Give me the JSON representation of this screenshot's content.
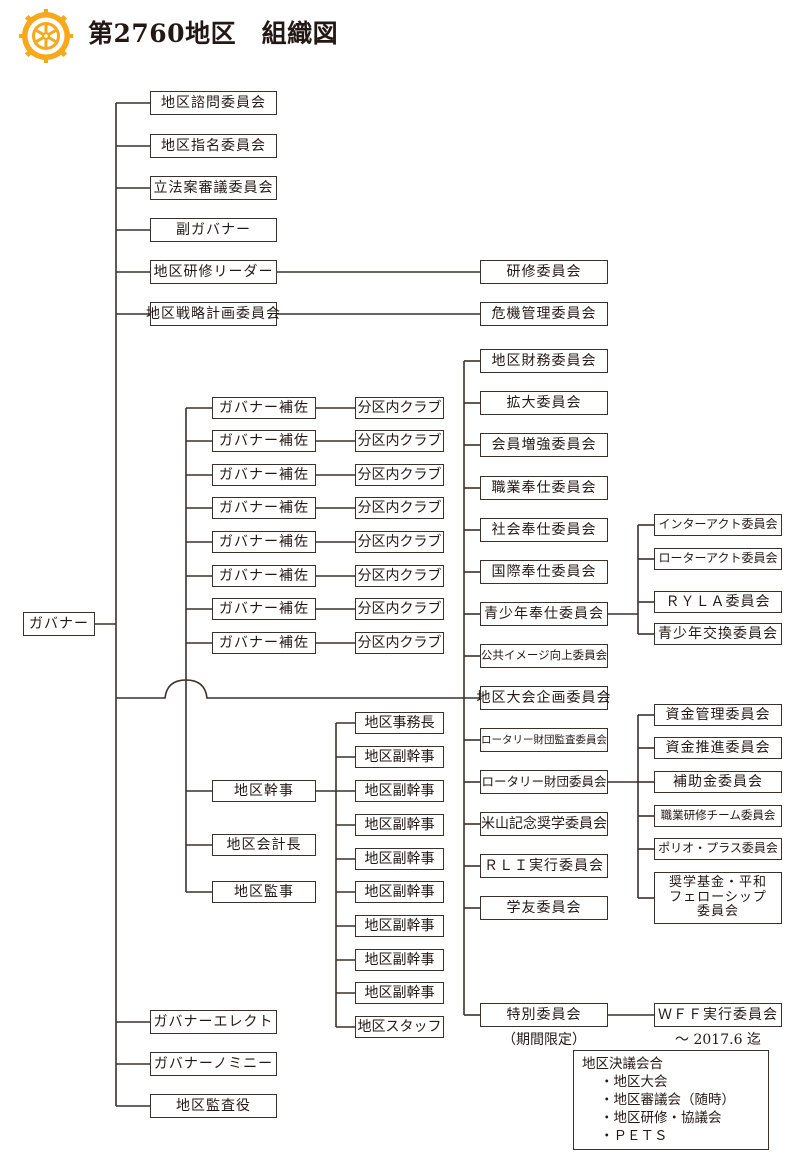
{
  "header": {
    "title": "第2760地区　組織図",
    "logo": "rotary-international-wheel-logo",
    "logo_color": "#F7A81B"
  },
  "line_color": "#3a302c",
  "root": {
    "label": "ガバナー"
  },
  "top_level": [
    {
      "label": "地区諮問委員会"
    },
    {
      "label": "地区指名委員会"
    },
    {
      "label": "立法案審議委員会"
    },
    {
      "label": "副ガバナー"
    },
    {
      "label": "地区研修リーダー",
      "child": "研修委員会"
    },
    {
      "label": "地区戦略計画委員会",
      "child": "危機管理委員会"
    }
  ],
  "assistant_governors": [
    {
      "label": "ガバナー補佐",
      "child": "分区内クラブ"
    },
    {
      "label": "ガバナー補佐",
      "child": "分区内クラブ"
    },
    {
      "label": "ガバナー補佐",
      "child": "分区内クラブ"
    },
    {
      "label": "ガバナー補佐",
      "child": "分区内クラブ"
    },
    {
      "label": "ガバナー補佐",
      "child": "分区内クラブ"
    },
    {
      "label": "ガバナー補佐",
      "child": "分区内クラブ"
    },
    {
      "label": "ガバナー補佐",
      "child": "分区内クラブ"
    },
    {
      "label": "ガバナー補佐",
      "child": "分区内クラブ"
    }
  ],
  "secretariat": {
    "main": [
      {
        "label": "地区幹事"
      },
      {
        "label": "地区会計長"
      },
      {
        "label": "地区監事"
      }
    ],
    "staff": [
      {
        "label": "地区事務長"
      },
      {
        "label": "地区副幹事"
      },
      {
        "label": "地区副幹事"
      },
      {
        "label": "地区副幹事"
      },
      {
        "label": "地区副幹事"
      },
      {
        "label": "地区副幹事"
      },
      {
        "label": "地区副幹事"
      },
      {
        "label": "地区副幹事"
      },
      {
        "label": "地区副幹事"
      },
      {
        "label": "地区スタッフ"
      }
    ]
  },
  "committees": [
    {
      "label": "地区財務委員会"
    },
    {
      "label": "拡大委員会"
    },
    {
      "label": "会員増強委員会"
    },
    {
      "label": "職業奉仕委員会"
    },
    {
      "label": "社会奉仕委員会"
    },
    {
      "label": "国際奉仕委員会"
    },
    {
      "label": "青少年奉仕委員会"
    },
    {
      "label": "公共イメージ向上委員会"
    },
    {
      "label": "地区大会企画委員会"
    },
    {
      "label": "ロータリー財団監査委員会"
    },
    {
      "label": "ロータリー財団委員会"
    },
    {
      "label": "米山記念奨学委員会"
    },
    {
      "label": "ＲＬＩ実行委員会"
    },
    {
      "label": "学友委員会"
    },
    {
      "label": "特別委員会",
      "note": "（期間限定）"
    }
  ],
  "youth_subcommittees": [
    {
      "label": "インターアクト委員会"
    },
    {
      "label": "ローターアクト委員会"
    },
    {
      "label": "ＲＹＬＡ委員会"
    },
    {
      "label": "青少年交換委員会"
    }
  ],
  "foundation_subcommittees": [
    {
      "label": "資金管理委員会"
    },
    {
      "label": "資金推進委員会"
    },
    {
      "label": "補助金委員会"
    },
    {
      "label": "職業研修チーム委員会"
    },
    {
      "label": "ポリオ・プラス委員会"
    },
    {
      "label": [
        "奨学基金・平和",
        "フェローシップ",
        "委員会"
      ]
    }
  ],
  "special_subcommittee": {
    "label": "ＷＦＦ実行委員会",
    "note": "～ 2017.6 迄"
  },
  "bottom_level": [
    {
      "label": "ガバナーエレクト"
    },
    {
      "label": "ガバナーノミニー"
    },
    {
      "label": "地区監査役"
    }
  ],
  "legend": {
    "title": "地区決議会合",
    "items": [
      "・地区大会",
      "・地区審議会（随時）",
      "・地区研修・協議会",
      "・ＰＥＴＳ"
    ]
  }
}
